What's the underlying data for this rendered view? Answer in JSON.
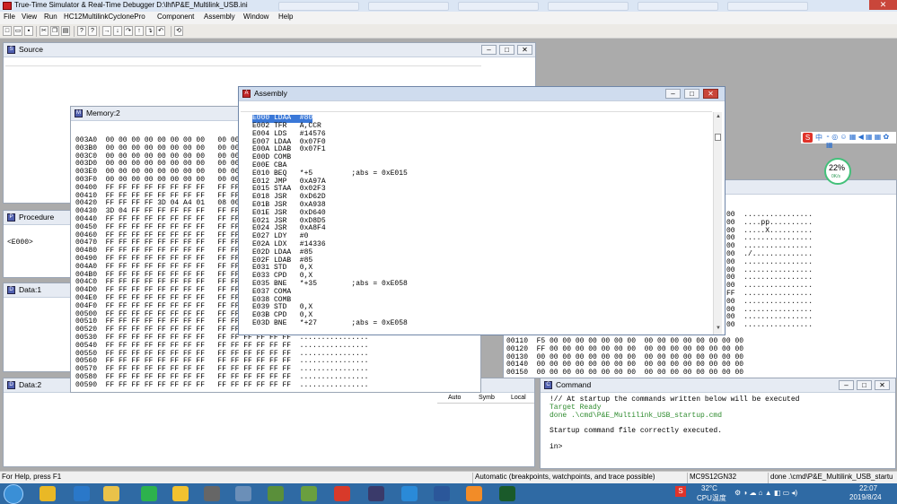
{
  "app": {
    "title": "True-Time Simulator & Real-Time Debugger   D:\\lhf\\P&E_Multilink_USB.ini",
    "close_glyph": "✕"
  },
  "menu": [
    "File",
    "View",
    "Run",
    "HC12MultilinkCyclonePro",
    "Component",
    "Assembly",
    "Window",
    "Help"
  ],
  "toolbar": {
    "buttons": [
      {
        "name": "new-icon",
        "glyph": "□"
      },
      {
        "name": "open-icon",
        "glyph": "▭"
      },
      {
        "name": "save-icon",
        "glyph": "▪"
      },
      {
        "name": "cut-icon",
        "glyph": "✂"
      },
      {
        "name": "copy-icon",
        "glyph": "❐"
      },
      {
        "name": "paste-icon",
        "glyph": "▤"
      },
      {
        "name": "help-icon",
        "glyph": "?"
      },
      {
        "name": "context-help-icon",
        "glyph": "?"
      },
      {
        "name": "start-icon",
        "glyph": "→"
      },
      {
        "name": "single-step-icon",
        "glyph": "↓"
      },
      {
        "name": "step-over-icon",
        "glyph": "↷"
      },
      {
        "name": "step-out-icon",
        "glyph": "↑"
      },
      {
        "name": "assembly-step-icon",
        "glyph": "↴"
      },
      {
        "name": "halt-icon",
        "glyph": "↶"
      },
      {
        "name": "reset-icon",
        "glyph": "⟲"
      }
    ]
  },
  "windows": {
    "source": {
      "title": "Source",
      "icon": "S"
    },
    "memory": {
      "title": "Memory:2",
      "icon": "M",
      "rows": [
        "003A0  00 00 00 00 00 00 00 00   00 00",
        "003B0  00 00 00 00 00 00 00 00   00 00",
        "003C0  00 00 00 00 00 00 00 00   00 00",
        "003D0  00 00 00 00 00 00 00 00   00 00",
        "003E0  00 00 00 00 00 00 00 00   00 00",
        "003F0  00 00 00 00 00 00 00 00   00 00",
        "00400  FF FF FF FF FF FF FF FF   FF FF",
        "00410  FF FF FF FF FF FF FF FF   FF FF",
        "00420  FF FF FF FF 3D 04 A4 01   08 00",
        "00430  3D 04 FF FF FF FF FF FF   FF FF",
        "00440  FF FF FF FF FF FF FF FF   FF FF",
        "00450  FF FF FF FF FF FF FF FF   FF FF",
        "00460  FF FF FF FF FF FF FF FF   FF FF",
        "00470  FF FF FF FF FF FF FF FF   FF FF",
        "00480  FF FF FF FF FF FF FF FF   FF FF",
        "00490  FF FF FF FF FF FF FF FF   FF FF",
        "004A0  FF FF FF FF FF FF FF FF   FF FF",
        "004B0  FF FF FF FF FF FF FF FF   FF FF",
        "004C0  FF FF FF FF FF FF FF FF   FF FF",
        "004D0  FF FF FF FF FF FF FF FF   FF FF",
        "004E0  FF FF FF FF FF FF FF FF   FF FF",
        "004F0  FF FF FF FF FF FF FF FF   FF FF",
        "00500  FF FF FF FF FF FF FF FF   FF FF",
        "00510  FF FF FF FF FF FF FF FF   FF FF",
        "00520  FF FF FF FF FF FF FF FF   FF FF FF FF FF FF  ................",
        "00530  FF FF FF FF FF FF FF FF   FF FF FF FF FF FF  ................",
        "00540  FF FF FF FF FF FF FF FF   FF FF FF FF FF FF  ................",
        "00550  FF FF FF FF FF FF FF FF   FF FF FF FF FF FF  ................",
        "00560  FF FF FF FF FF FF FF FF   FF FF FF FF FF FF  ................",
        "00570  FF FF FF FF FF FF FF FF   FF FF FF FF FF FF  ................",
        "00580  FF FF FF FF FF FF FF FF   FF FF FF FF FF FF  ................",
        "00590  FF FF FF FF FF FF FF FF   FF FF FF FF FF FF  ................"
      ]
    },
    "procedure": {
      "title": "Procedure",
      "icon": "P",
      "entry": "<E000>"
    },
    "data1": {
      "title": "Data:1",
      "icon": "D"
    },
    "data2": {
      "title": "Data:2",
      "icon": "D",
      "tabs": [
        "Auto",
        "Symb",
        "Local"
      ]
    },
    "assembly": {
      "title": "Assembly",
      "icon": "A",
      "highlighted_line": "E000 LDAA  #80",
      "lines": [
        "E002 TFR   A,CCR",
        "E004 LDS   #14576",
        "E007 LDAA  0x07F0",
        "E00A LDAB  0x07F1",
        "E00D COMB",
        "E00E CBA",
        "E010 BEQ   *+5         ;abs = 0xE015",
        "E012 JMP   0xA97A",
        "E015 STAA  0x02F3",
        "E018 JSR   0xD62D",
        "E01B JSR   0xA938",
        "E01E JSR   0xD640",
        "E021 JSR   0xD8D5",
        "E024 JSR   0xA8F4",
        "E027 LDY   #0",
        "E02A LDX   #14336",
        "E02D LDAA  #85",
        "E02F LDAB  #85",
        "E031 STD   0,X",
        "E033 CPD   0,X",
        "E035 BNE   *+35        ;abs = 0xE058",
        "E037 COMA",
        "E038 COMB",
        "E039 STD   0,X",
        "E03B CPD   0,X",
        "E03D BNE   *+27        ;abs = 0xE058"
      ]
    },
    "memory_right": {
      "rows_top": [
        "00  ................",
        "00  ....pp..........",
        "00  .....X..........",
        "00  ................",
        "00  ................",
        "00  ./..............",
        "00  ................",
        "00  ................",
        "00  ................",
        "00  ................",
        "FF  ................",
        "00  ................",
        "00  ................",
        "00  ................",
        "00  ................"
      ],
      "rows_bottom": [
        "00110  F5 00 00 00 00 00 00 00  00 00 00 00 00 00 00 00",
        "00120  FF 00 00 00 00 00 00 00  00 00 00 00 00 00 00 00",
        "00130  00 00 00 00 00 00 00 00  00 00 00 00 00 00 00 00",
        "00140  00 00 00 00 00 00 00 00  00 00 00 00 00 00 00 00",
        "00150  00 00 00 00 00 00 00 00  00 00 00 00 00 00 00 00"
      ]
    },
    "command": {
      "title": "Command",
      "icon": "C",
      "lines": [
        {
          "text": "!// At startup the commands written below will be executed",
          "color": "#000000"
        },
        {
          "text": "Target Ready",
          "color": "#2e8b2e"
        },
        {
          "text": "done .\\cmd\\P&E_Multilink_USB_startup.cmd",
          "color": "#2e8b2e"
        },
        {
          "text": "",
          "color": "#000000"
        },
        {
          "text": "Startup command file correctly executed.",
          "color": "#000000"
        },
        {
          "text": "",
          "color": "#000000"
        },
        {
          "text": "in>",
          "color": "#000000"
        }
      ]
    }
  },
  "statusbar": {
    "help": "For Help, press F1",
    "mode": "Automatic (breakpoints, watchpoints, and trace possible)",
    "chip": "MC9S12GN32",
    "last_cmd": "done .\\cmd\\P&E_Multilink_USB_startu"
  },
  "side_widget": {
    "cpu_percent": "22%",
    "net_speed": "0K/s",
    "toolbar_logo": "S",
    "toolbar_label": "中"
  },
  "taskbar": {
    "temperature": "32°C",
    "cpu_label": "CPU温度",
    "time": "22:07",
    "date": "2019/8/24",
    "apps": [
      {
        "name": "chrome-icon",
        "color": "#e9b826"
      },
      {
        "name": "sogou-browser-icon",
        "color": "#2a78c9"
      },
      {
        "name": "file-explorer-icon",
        "color": "#e9c24a"
      },
      {
        "name": "green-app-icon",
        "color": "#2db24d"
      },
      {
        "name": "nxp-icon",
        "color": "#f2c230"
      },
      {
        "name": "disk-tool-icon",
        "color": "#666666"
      },
      {
        "name": "calculator-icon",
        "color": "#6b8fb8"
      },
      {
        "name": "plane-app-icon",
        "color": "#5a8f3a"
      },
      {
        "name": "image-viewer-icon",
        "color": "#6a9f3f"
      },
      {
        "name": "recorder-icon",
        "color": "#d83a2a"
      },
      {
        "name": "media-icon",
        "color": "#3a3a6a"
      },
      {
        "name": "wps-icon",
        "color": "#2a8ad8"
      },
      {
        "name": "word-icon",
        "color": "#2b579a"
      },
      {
        "name": "orange-app-icon",
        "color": "#f28c28"
      },
      {
        "name": "codewarrior-icon",
        "color": "#1a5a2a"
      }
    ]
  }
}
